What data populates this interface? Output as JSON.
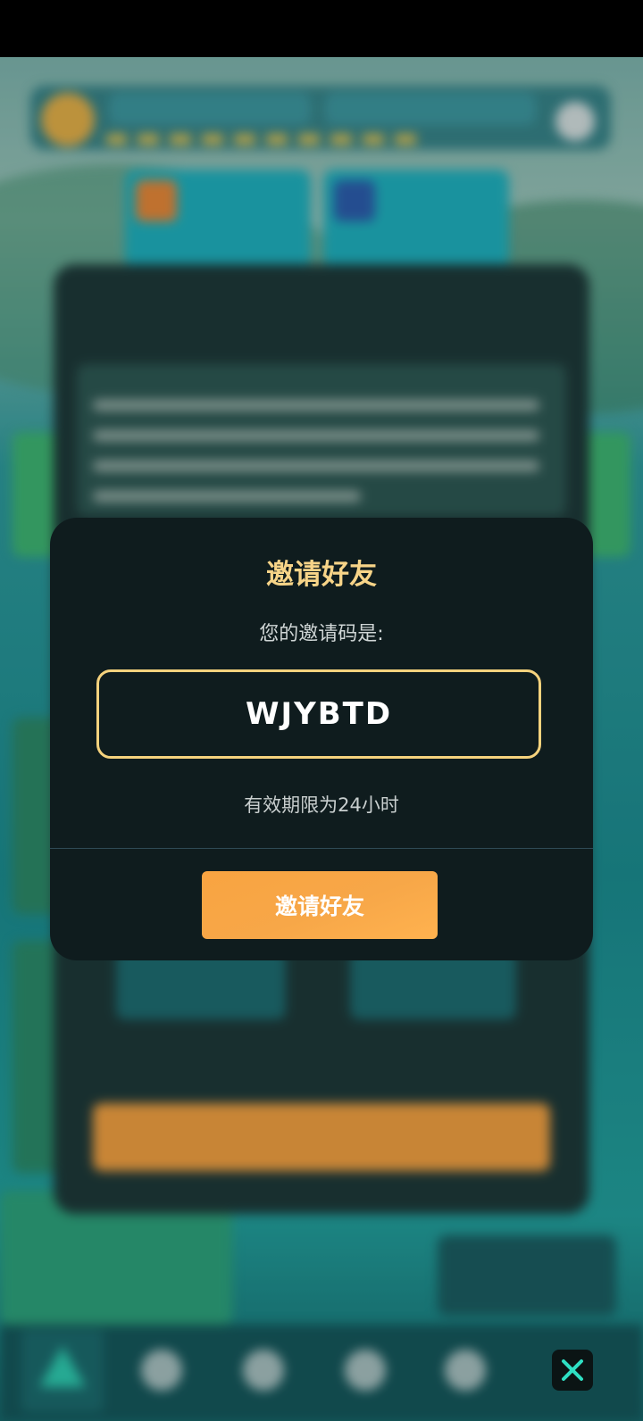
{
  "dialog": {
    "title": "邀请好友",
    "subtitle": "您的邀请码是:",
    "invite_code": "WJYBTD",
    "validity": "有效期限为24小时",
    "invite_button_label": "邀请好友"
  },
  "icons": {
    "close": "close-icon"
  },
  "colors": {
    "dialog_bg": "#0f1c1e",
    "title": "#f7d488",
    "code_border": "#f5d27d",
    "button": "#f9a441",
    "close_x": "#2fe0c4"
  }
}
